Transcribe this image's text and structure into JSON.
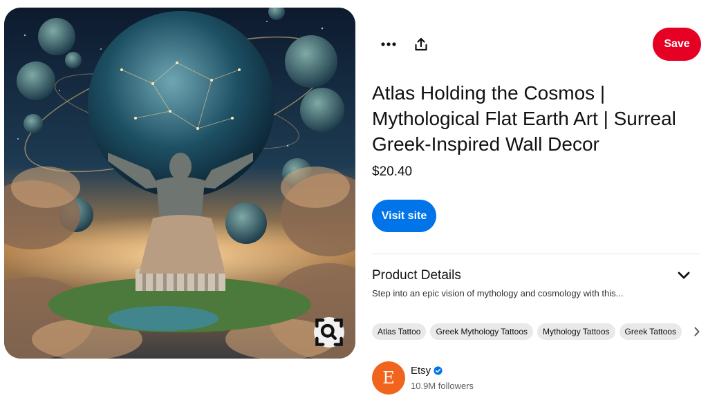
{
  "image": {
    "alt": "Atlas holding a cosmic globe above a Greek temple amid clouds and planets",
    "visual_search_icon": "visual-search-icon"
  },
  "actions": {
    "more_icon": "more-options-icon",
    "share_icon": "share-icon",
    "save_label": "Save",
    "save_color": "#e60023"
  },
  "pin": {
    "title": "Atlas Holding the Cosmos | Mythological Flat Earth Art | Surreal Greek-Inspired Wall Decor",
    "price": "$20.40",
    "visit_label": "Visit site",
    "visit_color": "#0074e8"
  },
  "details": {
    "heading": "Product Details",
    "description": "Step into an epic vision of mythology and cosmology with this...",
    "toggle_icon": "chevron-down-icon"
  },
  "tags": [
    "Atlas Tattoo",
    "Greek Mythology Tattoos",
    "Mythology Tattoos",
    "Greek Tattoos"
  ],
  "creator": {
    "avatar_letter": "E",
    "avatar_color": "#f1641e",
    "name": "Etsy",
    "followers": "10.9M followers",
    "verified_icon": "verified-badge-icon"
  }
}
